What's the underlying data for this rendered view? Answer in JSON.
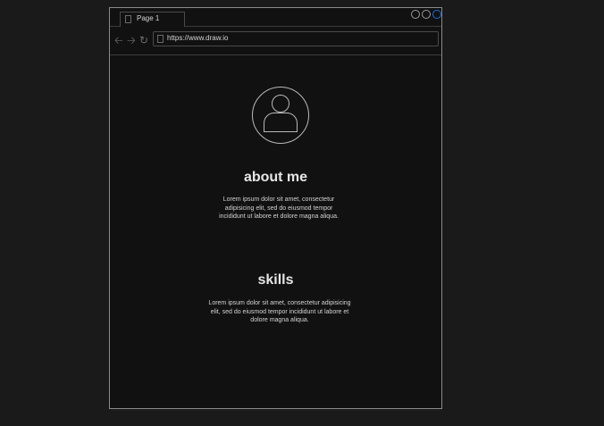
{
  "browser": {
    "tab_label": "Page 1",
    "url": "https://www.draw.io",
    "window_button_colors": [
      "#9a9a9a",
      "#9a9a9a",
      "#1e6fd9"
    ]
  },
  "about": {
    "heading": "about me",
    "text": "Lorem ipsum dolor sit amet, consectetur adipisicing elit, sed do eiusmod tempor incididunt ut labore et dolore magna aliqua."
  },
  "skills": {
    "heading": "skills",
    "text": "Lorem ipsum dolor sit amet, consectetur adipisicing elit, sed do eiusmod tempor incididunt ut labore et dolore magna aliqua."
  }
}
